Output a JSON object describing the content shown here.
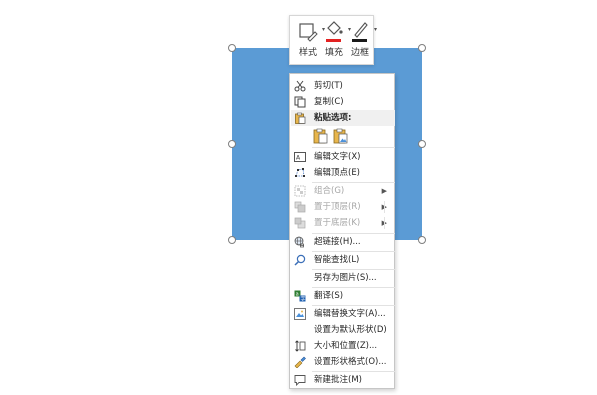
{
  "mini_toolbar": {
    "style_label": "样式",
    "fill_label": "填充",
    "border_label": "边框",
    "fill_color": "#e32222",
    "border_color": "#1a1a1a"
  },
  "shape": {
    "fill_color": "#5b9bd5"
  },
  "context_menu": {
    "cut": "剪切(T)",
    "copy": "复制(C)",
    "paste_options": "粘贴选项:",
    "edit_text": "编辑文字(X)",
    "edit_points": "编辑顶点(E)",
    "group": "组合(G)",
    "bring_to_front": "置于顶层(R)",
    "send_to_back": "置于底层(K)",
    "hyperlink": "超链接(H)...",
    "smart_lookup": "智能查找(L)",
    "save_as_picture": "另存为图片(S)...",
    "translate": "翻译(S)",
    "edit_alt_text": "编辑替换文字(A)...",
    "set_default_shape": "设置为默认形状(D)",
    "size_position": "大小和位置(Z)...",
    "format_shape": "设置形状格式(O)...",
    "new_comment": "新建批注(M)"
  }
}
